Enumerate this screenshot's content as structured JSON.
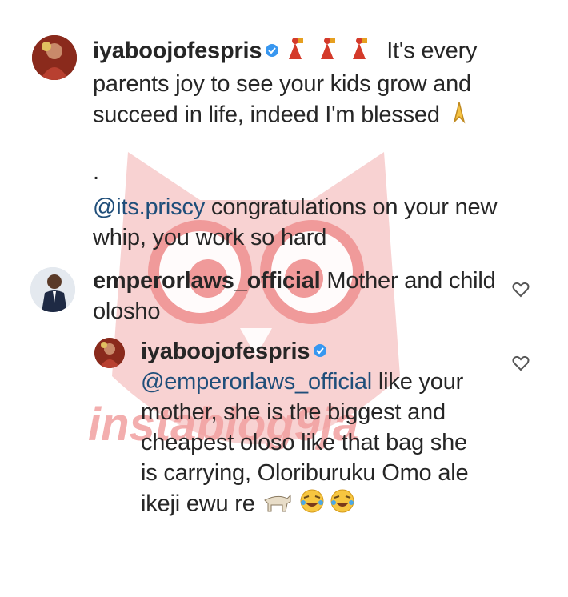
{
  "comments": [
    {
      "username": "iyaboojofespris",
      "verified": true,
      "emoji_after_username": "dancer-emoji x3",
      "text_1": "It's every parents joy to see your kids grow and succeed in life, indeed I'm blessed",
      "emoji_after_text": "folded-hands-emoji",
      "separator": ".",
      "mention": "@its.priscy",
      "text_2": "congratulations on your new whip, you work so hard"
    },
    {
      "username": "emperorlaws_official",
      "verified": false,
      "text": "Mother and child olosho"
    },
    {
      "username": "iyaboojofespris",
      "verified": true,
      "is_reply": true,
      "mention": "@emperorlaws_official",
      "text": "like your mother, she is the biggest and cheapest oloso like that bag she is carrying, Oloriburuku Omo ale ikeji ewu re",
      "emoji_after_text": "goat-emoji, tears-of-joy-emoji x2"
    }
  ],
  "watermark": "instablog9ja",
  "colors": {
    "mention": "#1f4e7a",
    "verified": "#3897f0",
    "watermark": "#f3a9a9"
  }
}
